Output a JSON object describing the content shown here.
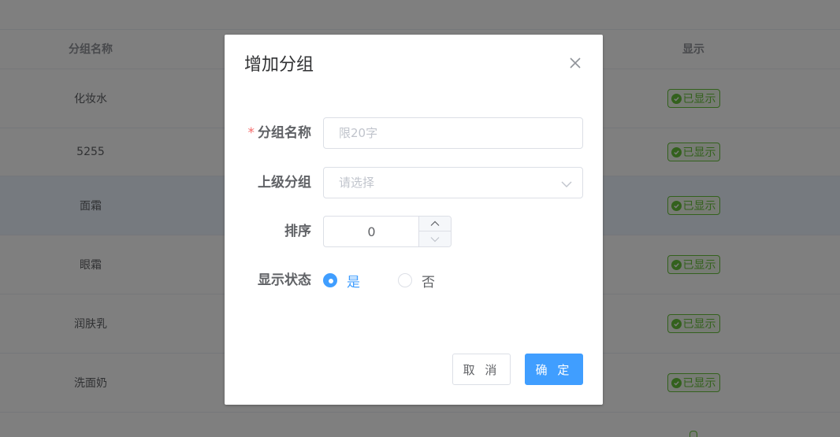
{
  "table": {
    "headers": {
      "name": "分组名称",
      "show": "显示"
    },
    "rows": [
      {
        "name": "化妆水",
        "status": "已显示"
      },
      {
        "name": "5255",
        "status": "已显示"
      },
      {
        "name": "面霜",
        "status": "已显示"
      },
      {
        "name": "眼霜",
        "status": "已显示"
      },
      {
        "name": "润肤乳",
        "status": "已显示"
      },
      {
        "name": "洗面奶",
        "status": "已显示"
      },
      {
        "name": "",
        "status": ""
      }
    ]
  },
  "dialog": {
    "title": "增加分组",
    "fields": {
      "name": {
        "required_mark": "*",
        "label": "分组名称",
        "placeholder": "限20字",
        "value": ""
      },
      "parent": {
        "label": "上级分组",
        "placeholder": "请选择",
        "value": ""
      },
      "sort": {
        "label": "排序",
        "value": "0"
      },
      "visibility": {
        "label": "显示状态",
        "options": [
          {
            "label": "是",
            "checked": true
          },
          {
            "label": "否",
            "checked": false
          }
        ]
      }
    },
    "buttons": {
      "cancel": "取 消",
      "confirm": "确 定"
    }
  },
  "icons": {
    "close": "close-icon",
    "select_arrow": "chevron-down-icon",
    "increase": "chevron-up-icon",
    "decrease": "chevron-down-icon",
    "status_check": "check-circle-icon"
  },
  "colors": {
    "primary": "#409eff",
    "success": "#67c23a",
    "danger": "#f56c6c",
    "mask": "rgba(0,0,0,0.5)"
  }
}
